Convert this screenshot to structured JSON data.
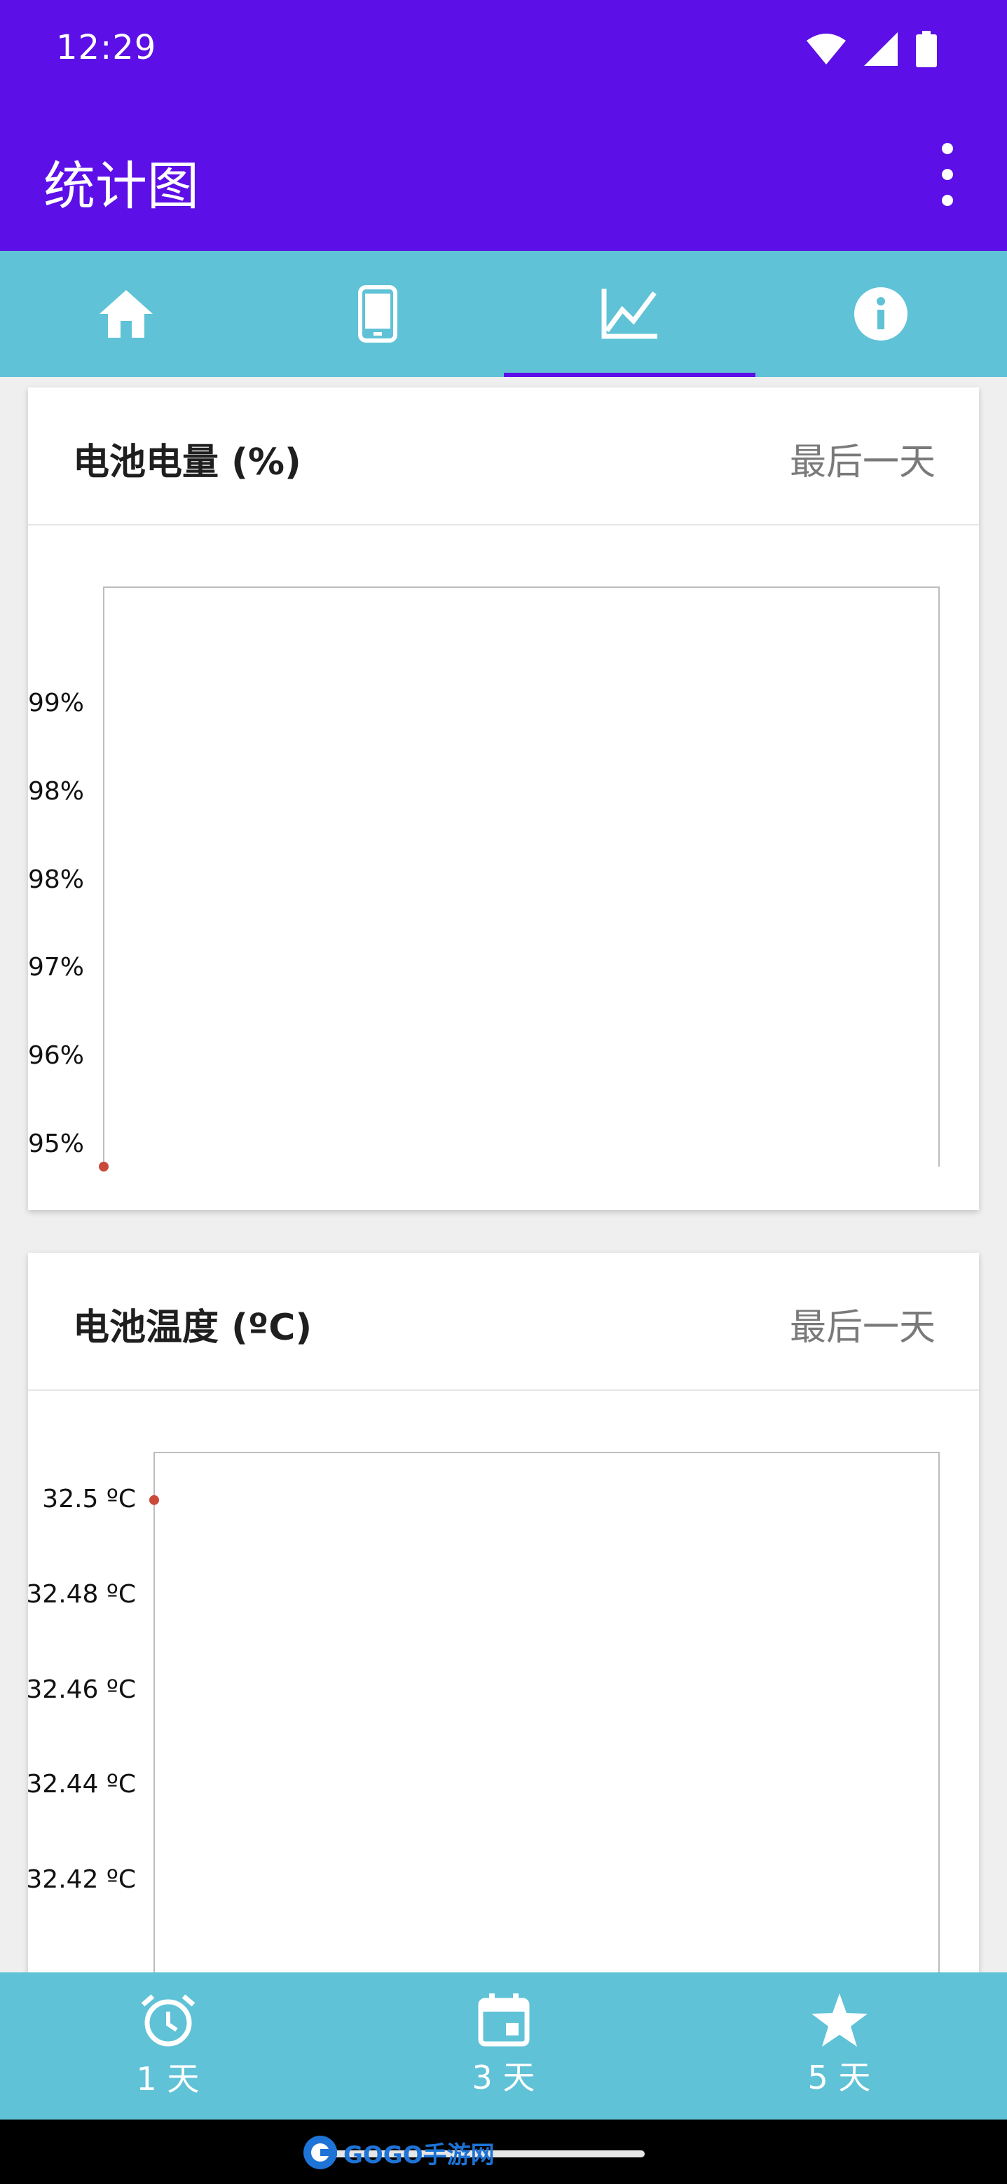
{
  "status_bar": {
    "time": "12:29"
  },
  "app_bar": {
    "title": "统计图"
  },
  "top_tabs": [
    {
      "name": "home",
      "icon": "home-icon"
    },
    {
      "name": "device",
      "icon": "phone-icon"
    },
    {
      "name": "charts",
      "icon": "chart-icon",
      "active": true
    },
    {
      "name": "info",
      "icon": "info-icon"
    }
  ],
  "cards": [
    {
      "title": "电池电量 (%)",
      "range": "最后一天"
    },
    {
      "title": "电池温度 (ºC)",
      "range": "最后一天"
    }
  ],
  "chart_data": [
    {
      "type": "line",
      "title": "电池电量 (%)",
      "yticks": [
        "99%",
        "98%",
        "98%",
        "97%",
        "96%",
        "95%"
      ],
      "ytick_values": [
        99,
        98.4,
        97.8,
        97.2,
        96.6,
        96.0
      ],
      "ylim": [
        95.85,
        99.8
      ],
      "points": [
        {
          "x": 0,
          "y": 95.85
        }
      ],
      "grid": false,
      "color": "#c94a3a"
    },
    {
      "type": "line",
      "title": "电池温度 (ºC)",
      "yticks": [
        "32.5 ºC",
        "32.48 ºC",
        "32.46 ºC",
        "32.44 ºC",
        "32.42 ºC"
      ],
      "ytick_values": [
        32.5,
        32.48,
        32.46,
        32.44,
        32.42
      ],
      "ylim": [
        32.39,
        32.51
      ],
      "points": [
        {
          "x": 0,
          "y": 32.5
        }
      ],
      "grid": false,
      "color": "#c94a3a"
    }
  ],
  "bottom_nav": [
    {
      "label": "1 天",
      "icon": "alarm-clock-icon"
    },
    {
      "label": "3 天",
      "icon": "calendar-icon"
    },
    {
      "label": "5 天",
      "icon": "star-icon"
    }
  ],
  "watermark": {
    "text": "GOGO手游网"
  },
  "colors": {
    "primary": "#5c0fe6",
    "accent": "#5fc2d6",
    "point": "#c94a3a"
  }
}
